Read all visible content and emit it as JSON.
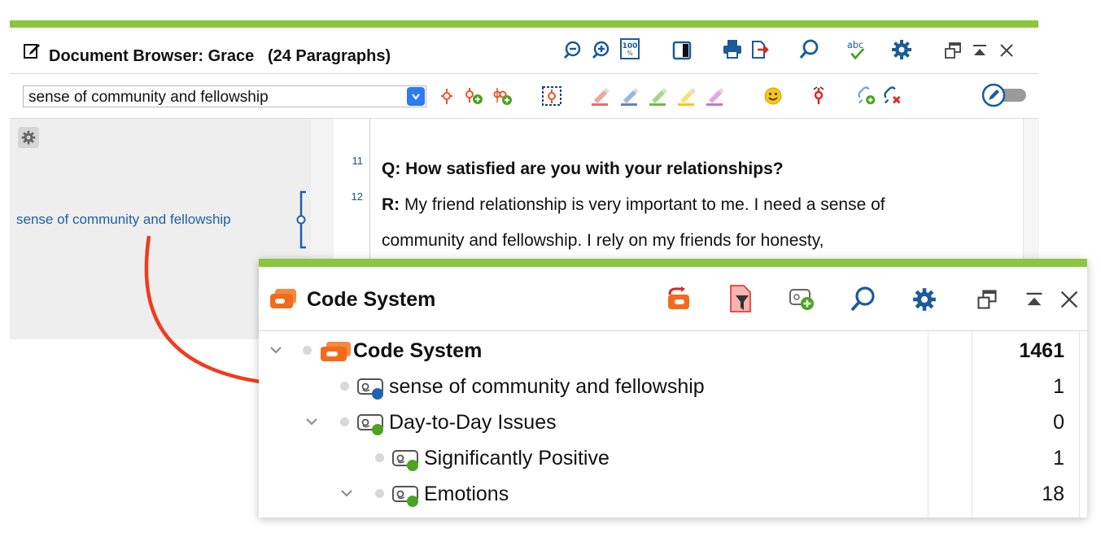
{
  "colors": {
    "accent_green": "#8cc63e",
    "link_blue": "#1f5fa6",
    "icon_blue": "#1b5a9b",
    "arrow_red": "#ef3b1f",
    "code_orange": "#f26b1d",
    "code_blue_dot": "#1f62b0",
    "code_green_dot": "#4aa321"
  },
  "document_browser": {
    "title": "Document Browser: Grace",
    "paragraph_count": "(24 Paragraphs)",
    "active_code": "sense of community and fellowship",
    "title_icons": [
      "zoom-out-icon",
      "zoom-in-icon",
      "zoom-100-icon",
      "side-panel-icon",
      "print-icon",
      "export-icon",
      "search-icon",
      "spellcheck-icon",
      "settings-gear-icon",
      "undock-window-icon",
      "collapse-icon",
      "close-icon"
    ],
    "toolbar_icons": [
      "code-icon",
      "code-add-icon",
      "code-in-vivo-icon",
      "code-selection-icon",
      "highlighter-red-icon",
      "highlighter-blue-icon",
      "highlighter-green-icon",
      "highlighter-yellow-icon",
      "highlighter-purple-icon",
      "emoticon-icon",
      "code-cancel-icon",
      "link-add-icon",
      "link-remove-icon",
      "edit-mode-toggle"
    ],
    "margin": {
      "code_label": "sense of community and fellowship"
    },
    "paragraphs": [
      {
        "number": "11",
        "lines": [
          {
            "bold_prefix": "Q: How satisfied are you with your relationships?",
            "text": ""
          }
        ]
      },
      {
        "number": "12",
        "lines": [
          {
            "bold_prefix": "R:",
            "text": " My friend relationship is very important to me. I need a sense of"
          },
          {
            "bold_prefix": "",
            "text": "community and fellowship. I rely on my friends for honesty,"
          }
        ]
      }
    ]
  },
  "code_system": {
    "title": "Code System",
    "header_icons": [
      "reset-activations-icon",
      "filter-icon",
      "new-code-icon",
      "search-icon",
      "settings-gear-icon",
      "undock-window-icon",
      "collapse-icon",
      "close-icon"
    ],
    "rows": [
      {
        "label": "Code System",
        "count": "1461",
        "bold": true,
        "expandable": true,
        "icon": "code-system-icon"
      },
      {
        "label": "sense of community and fellowship",
        "count": "1",
        "bold": false,
        "expandable": false,
        "icon": "code-tag-icon",
        "color": "#1f62b0"
      },
      {
        "label": "Day-to-Day Issues",
        "count": "0",
        "bold": false,
        "expandable": true,
        "icon": "code-tag-icon",
        "color": "#4aa321"
      },
      {
        "label": "Significantly Positive",
        "count": "1",
        "bold": false,
        "expandable": false,
        "icon": "code-tag-icon",
        "color": "#4aa321"
      },
      {
        "label": "Emotions",
        "count": "18",
        "bold": false,
        "expandable": true,
        "icon": "code-tag-icon",
        "color": "#4aa321"
      }
    ]
  }
}
